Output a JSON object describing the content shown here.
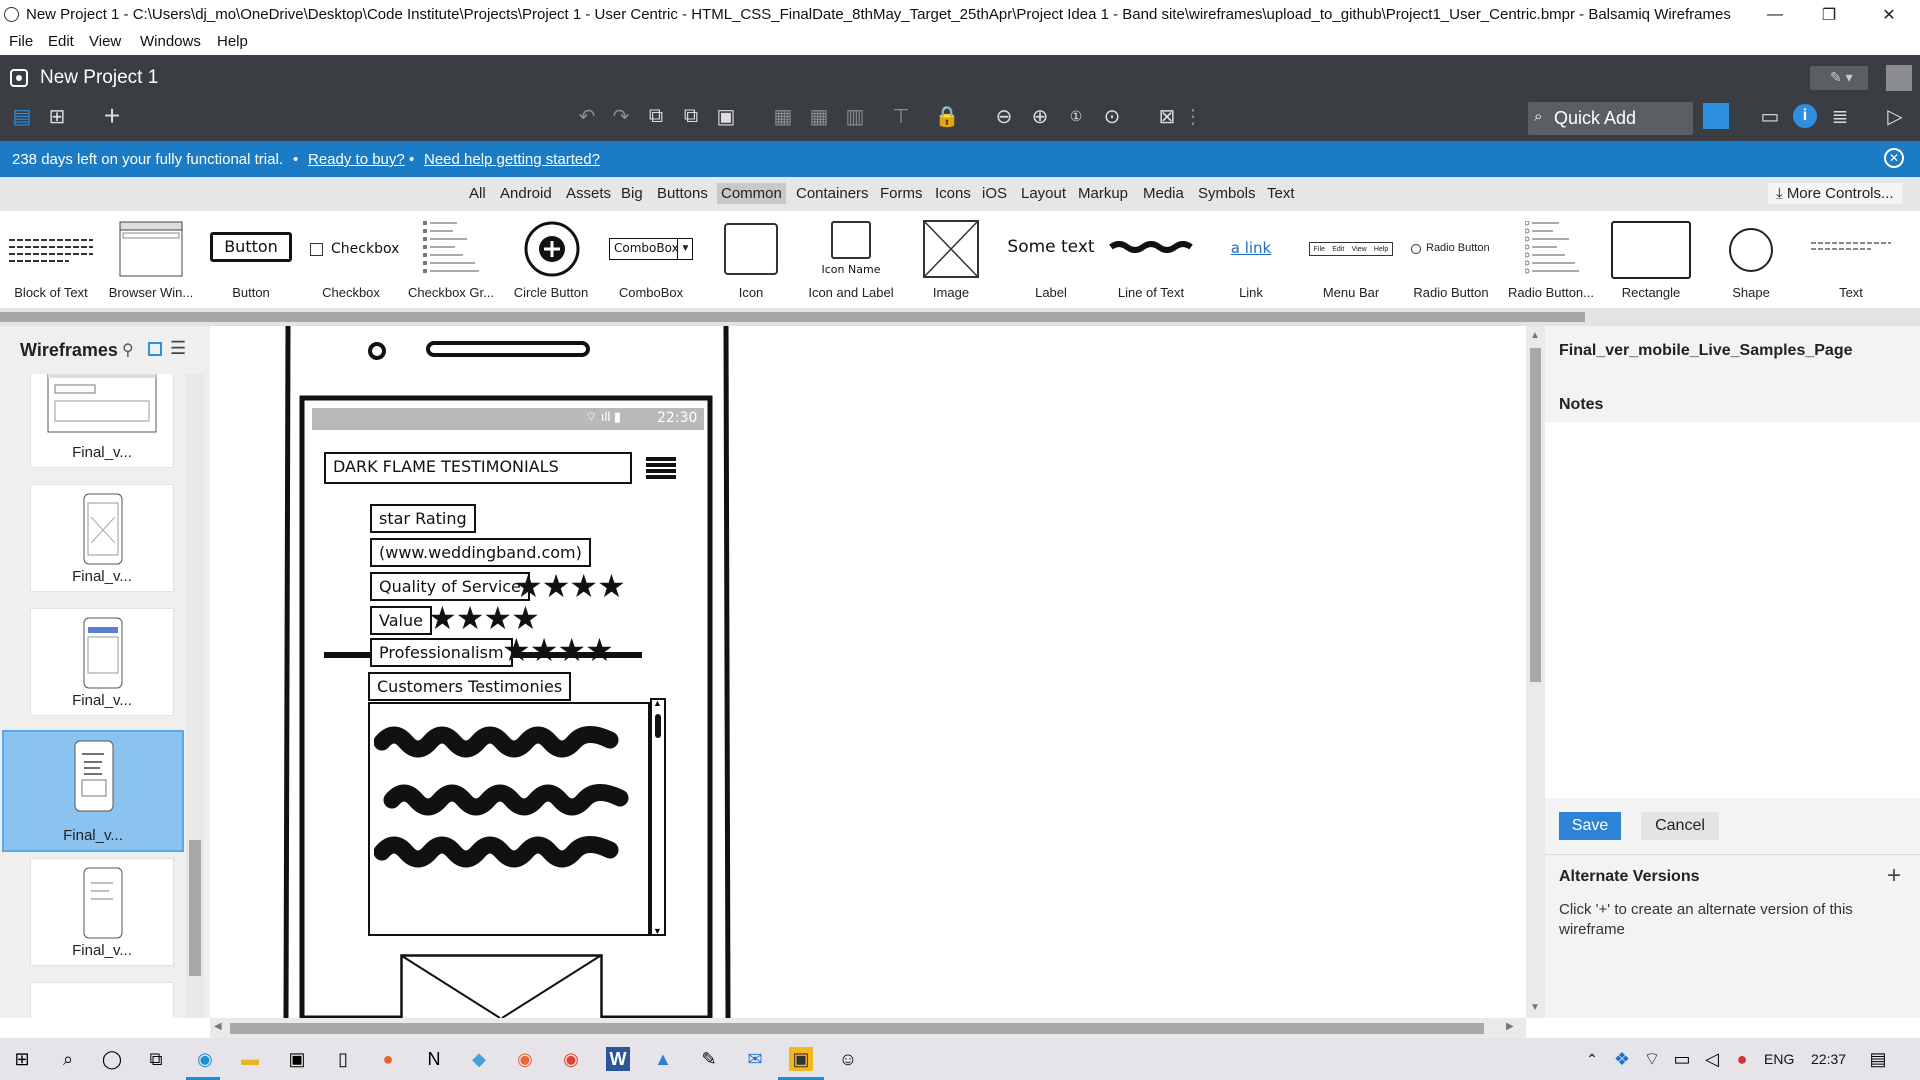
{
  "window": {
    "title": "New Project 1 - C:\\Users\\dj_mo\\OneDrive\\Desktop\\Code Institute\\Projects\\Project 1 - User Centric - HTML_CSS_FinalDate_8thMay_Target_25thApr\\Project Idea 1 - Band site\\wireframes\\upload_to_github\\Project1_User_Centric.bmpr - Balsamiq Wireframes",
    "minimize": "—",
    "restore": "❐",
    "close": "✕"
  },
  "menu": [
    "File",
    "Edit",
    "View",
    "Windows",
    "Help"
  ],
  "project": {
    "name": "New Project 1",
    "quick_add": "Quick Add"
  },
  "trial": {
    "message": "238 days left on your fully functional trial.",
    "sep": "•",
    "buy_link": "Ready to buy?",
    "help_link": "Need help getting started?"
  },
  "filters": {
    "tabs": [
      "All",
      "Android",
      "Assets",
      "Big",
      "Buttons",
      "Common",
      "Containers",
      "Forms",
      "Icons",
      "iOS",
      "Layout",
      "Markup",
      "Media",
      "Symbols",
      "Text"
    ],
    "selected": "Common",
    "more_controls": "More Controls..."
  },
  "library": {
    "items": [
      "Block of Text",
      "Browser Win...",
      "Button",
      "Checkbox",
      "Checkbox Gr...",
      "Circle Button",
      "ComboBox",
      "Icon",
      "Icon and Label",
      "Image",
      "Label",
      "Line of Text",
      "Link",
      "Menu Bar",
      "Radio Button",
      "Radio Button...",
      "Rectangle",
      "Shape",
      "Text"
    ],
    "previews": {
      "button": "Button",
      "checkbox": "Checkbox",
      "combobox": "ComboBox",
      "icon_name": "Icon Name",
      "label": "Some text",
      "link": "a link",
      "radio": "Radio Button",
      "menubar": [
        "File",
        "Edit",
        "View",
        "Help"
      ]
    }
  },
  "sidebar": {
    "title": "Wireframes",
    "thumbs": [
      "Final_v...",
      "Final_v...",
      "Final_v...",
      "Final_v...",
      "Final_v..."
    ],
    "selected_index": 3
  },
  "wireframe": {
    "status_time": "22:30",
    "header": "DARK FLAME TESTIMONIALS",
    "star_rating": "star Rating",
    "url": "(www.weddingband.com)",
    "quality": {
      "label": "Quality of Service",
      "stars": 4
    },
    "value": {
      "label": "Value",
      "stars": 4
    },
    "professionalism": {
      "label": "Professionalism",
      "stars": 4
    },
    "testimonials": "Customers Testimonies"
  },
  "right_panel": {
    "wireframe_name": "Final_ver_mobile_Live_Samples_Page",
    "notes_label": "Notes",
    "save": "Save",
    "cancel": "Cancel",
    "alt_versions": "Alternate Versions",
    "alt_help": "Click '+' to create an alternate version of this wireframe"
  },
  "taskbar": {
    "lang": "ENG",
    "time": "22:37"
  },
  "colors": {
    "accent": "#1b7bc4",
    "dark_toolbar": "#3a3d42",
    "selected_thumb": "#8ac3f0",
    "save_button": "#2f83d6"
  }
}
